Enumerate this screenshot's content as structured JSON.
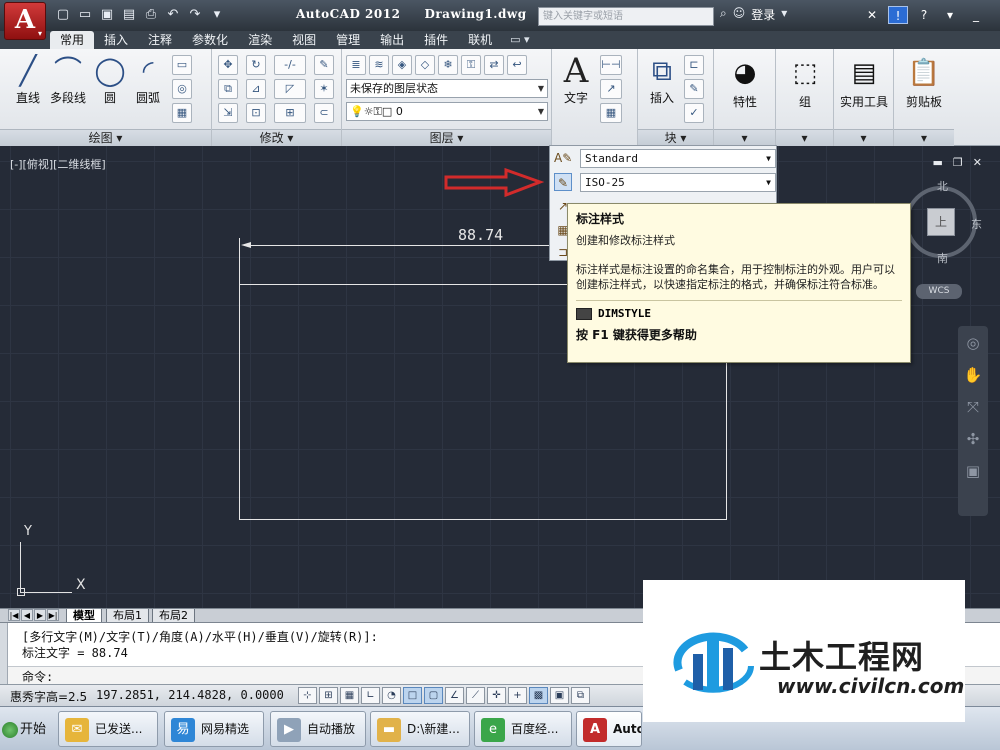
{
  "titlebar": {
    "app_name": "AutoCAD 2012",
    "document": "Drawing1.dwg",
    "search_placeholder": "键入关键字或短语",
    "login": "登录"
  },
  "ribbon_tabs": [
    "常用",
    "插入",
    "注释",
    "参数化",
    "渲染",
    "视图",
    "管理",
    "输出",
    "插件",
    "联机"
  ],
  "draw_panel": {
    "line": "直线",
    "polyline": "多段线",
    "circle": "圆",
    "arc": "圆弧",
    "footer": "绘图 ▾"
  },
  "modify_panel": {
    "footer": "修改 ▾"
  },
  "layer_panel": {
    "state": "未保存的图层状态",
    "current_layer": "0",
    "footer": "图层 ▾"
  },
  "annotation": {
    "text": "文字"
  },
  "block_panel": {
    "insert": "插入",
    "footer": "块 ▾"
  },
  "right_panels": {
    "properties": "特性",
    "group": "组",
    "utilities": "实用工具",
    "clipboard": "剪贴板"
  },
  "viewport": {
    "label": "[-][俯视][二维线框]",
    "dimension_value": "88.74",
    "compass": {
      "north": "北",
      "east": "东",
      "south": "南",
      "top": "上"
    },
    "wcs": "WCS",
    "ucs_x": "X",
    "ucs_y": "Y"
  },
  "flyout": {
    "text_style": "Standard",
    "dim_style": "ISO-25"
  },
  "tooltip": {
    "title": "标注样式",
    "subtitle": "创建和修改标注样式",
    "body": "标注样式是标注设置的命名集合，用于控制标注的外观。用户可以创建标注样式，以快速指定标注的格式，并确保标注符合标准。",
    "command": "DIMSTYLE",
    "help": "按 F1 键获得更多帮助"
  },
  "layout_tabs": [
    "模型",
    "布局1",
    "布局2"
  ],
  "command_window": {
    "line1": "[多行文字(M)/文字(T)/角度(A)/水平(H)/垂直(V)/旋转(R)]:",
    "line2": "标注文字 = 88.74",
    "prompt": "命令:"
  },
  "statusbar": {
    "left": "惠秀字高=2.5",
    "coords": "197.2851, 214.4828, 0.0000"
  },
  "taskbar": {
    "start": "开始",
    "items": [
      "已发送...",
      "网易精选",
      "自动播放",
      "D:\\新建...",
      "百度经...",
      "AutoC"
    ]
  },
  "watermark": {
    "name": "土木工程网",
    "url": "www.civilcn.com"
  },
  "colors": {
    "canvas_bg": "#252b37",
    "accent_red": "#d22b2b",
    "tooltip_bg": "#fffbe1"
  }
}
